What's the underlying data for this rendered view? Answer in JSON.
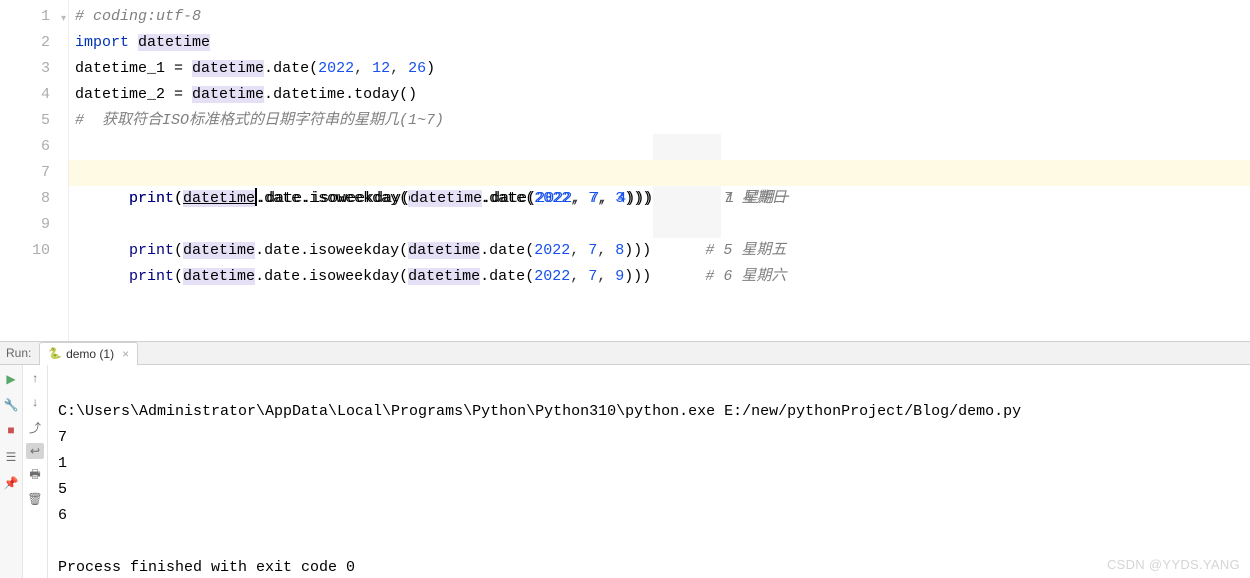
{
  "gutter_lines": [
    "1",
    "2",
    "3",
    "4",
    "5",
    "6",
    "7",
    "8",
    "9",
    "10"
  ],
  "code": {
    "l1_comment": "# coding:utf-8",
    "l2_kw": "import",
    "l2_mod": "datetime",
    "l3_lhs": "datetime_1",
    "l3_eq": " = ",
    "l3_m": "datetime",
    "l3_d": ".",
    "l3_c": "date",
    "l3_n1": "2022",
    "l3_n2": "12",
    "l3_n3": "26",
    "l4_lhs": "datetime_2",
    "l4_eq": " = ",
    "l4_m": "datetime",
    "l4_c2": "datetime",
    "l4_c3": "today",
    "l5_comment": "#  获取符合ISO标准格式的日期字符串的星期几(1~7)",
    "l6_p": "print",
    "l6_m": "datetime",
    "l6_d": "date",
    "l6_f": "isoweekday",
    "l6_m2": "datetime",
    "l6_d2": "date",
    "l6_n1": "2022",
    "l6_n2": "7",
    "l6_n3": "3",
    "l6_c": "# 7 星期日",
    "l7_p": "print",
    "l7_m": "datetime",
    "l7_d": "date",
    "l7_f": "isoweekday",
    "l7_m2": "datetime",
    "l7_d2": "date",
    "l7_n1": "2022",
    "l7_n2": "7",
    "l7_n3": "4",
    "l7_c": "# 1 星期一",
    "l8_p": "print",
    "l8_m": "datetime",
    "l8_d": "date",
    "l8_f": "isoweekday",
    "l8_m2": "datetime",
    "l8_d2": "date",
    "l8_n1": "2022",
    "l8_n2": "7",
    "l8_n3": "8",
    "l8_c": "# 5 星期五",
    "l9_p": "print",
    "l9_m": "datetime",
    "l9_d": "date",
    "l9_f": "isoweekday",
    "l9_m2": "datetime",
    "l9_d2": "date",
    "l9_n1": "2022",
    "l9_n2": "7",
    "l9_n3": "9",
    "l9_c": "# 6 星期六"
  },
  "run_header_label": "Run:",
  "run_tab_label": "demo (1)",
  "console_lines": [
    "C:\\Users\\Administrator\\AppData\\Local\\Programs\\Python\\Python310\\python.exe E:/new/pythonProject/Blog/demo.py",
    "7",
    "1",
    "5",
    "6",
    "",
    "Process finished with exit code 0"
  ],
  "watermark": "CSDN @YYDS.YANG"
}
